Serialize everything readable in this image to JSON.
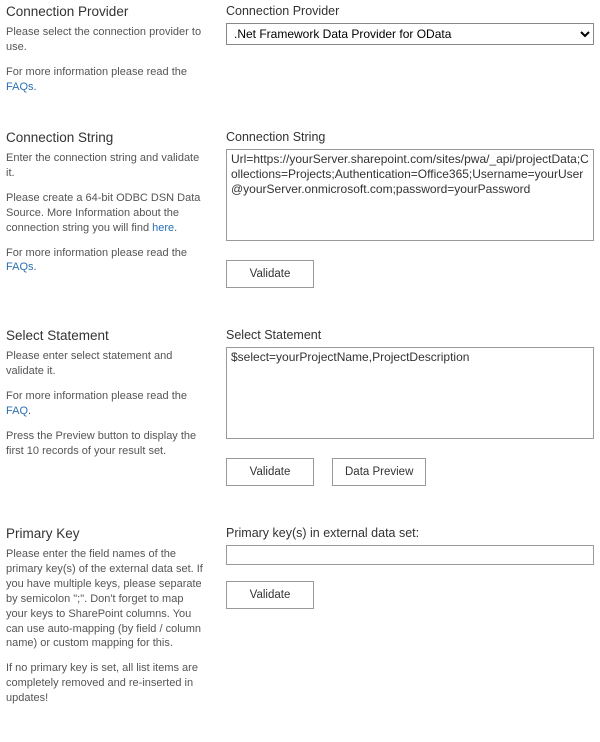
{
  "provider": {
    "left_heading": "Connection Provider",
    "left_p1": "Please select the connection provider to use.",
    "left_p2_a": "For more information please read the ",
    "left_p2_link": "FAQs",
    "left_p2_b": ".",
    "right_label": "Connection Provider",
    "value": ".Net Framework Data Provider for OData"
  },
  "connection": {
    "left_heading": "Connection String",
    "left_p1": "Enter the connection string and validate it.",
    "left_p2_a": "Please create a 64-bit ODBC DSN Data Source. More Information about the connection string you will find ",
    "left_p2_link": "here",
    "left_p2_b": ".",
    "left_p3_a": "For more information please read the ",
    "left_p3_link": "FAQs",
    "left_p3_b": ".",
    "right_label": "Connection String",
    "value": "Url=https://yourServer.sharepoint.com/sites/pwa/_api/projectData;Collections=Projects;Authentication=Office365;Username=yourUser@yourServer.onmicrosoft.com;password=yourPassword",
    "validate_label": "Validate"
  },
  "select": {
    "left_heading": "Select Statement",
    "left_p1": "Please enter select statement and validate it.",
    "left_p2_a": "For more information please read the ",
    "left_p2_link": "FAQ",
    "left_p2_b": ".",
    "left_p3": "Press the Preview button to display the first 10 records of your result set.",
    "right_label": "Select Statement",
    "value": "$select=yourProjectName,ProjectDescription",
    "validate_label": "Validate",
    "preview_label": "Data Preview"
  },
  "pk": {
    "left_heading": "Primary Key",
    "left_p1": "Please enter the field names of the primary key(s) of the external data set. If you have multiple keys, please separate by semicolon \";\". Don't forget to map your keys to SharePoint columns. You can use auto-mapping (by field / column name) or custom mapping for this.",
    "left_p2": "If no primary key is set, all list items are completely removed and re-inserted in updates!",
    "right_label": "Primary key(s) in external data set:",
    "value": "",
    "validate_label": "Validate"
  }
}
